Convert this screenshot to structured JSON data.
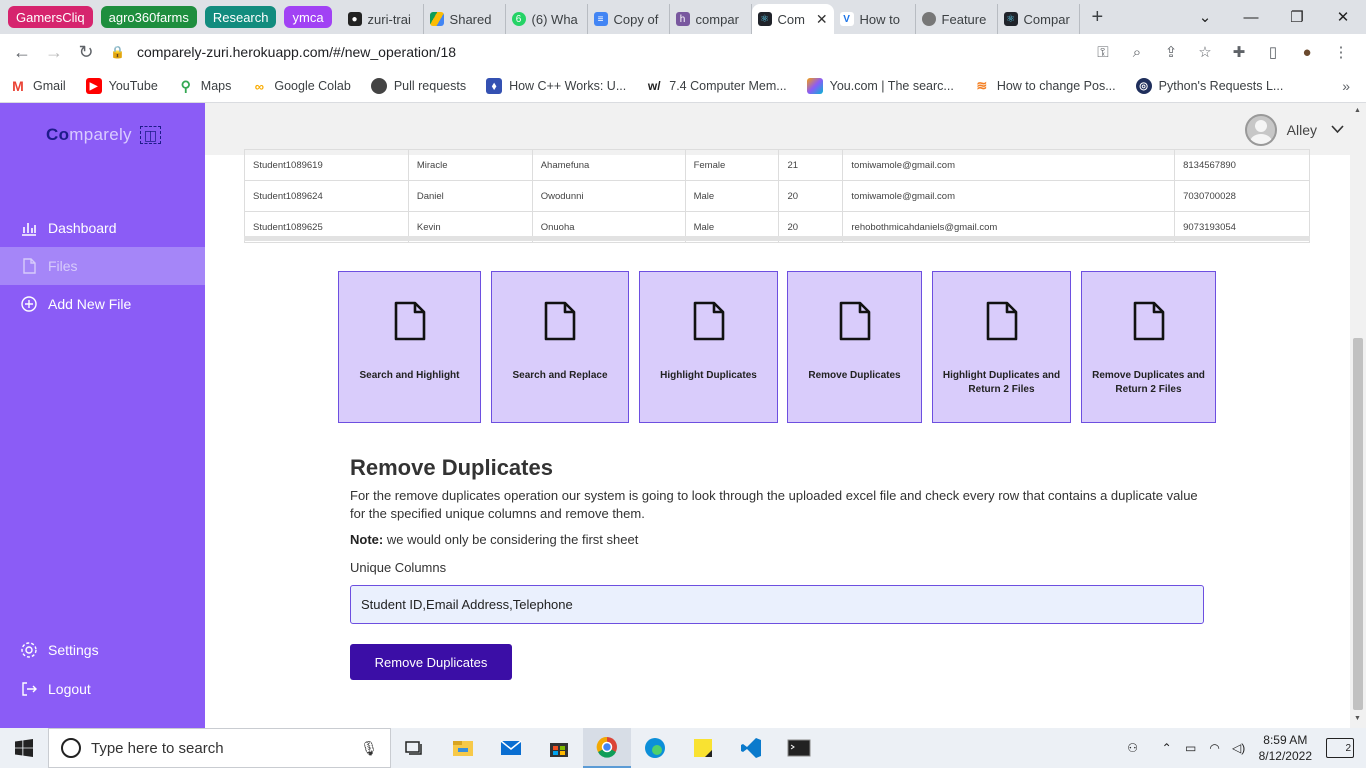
{
  "browser": {
    "tab_groups": [
      {
        "label": "GamersCliq",
        "color": "#d6246e"
      },
      {
        "label": "agro360farms",
        "color": "#1e8e3e"
      },
      {
        "label": "Research",
        "color": "#128c7e"
      },
      {
        "label": "ymca",
        "color": "#a142f4"
      }
    ],
    "tabs": [
      {
        "label": "zuri-trai",
        "icon": "github-icon"
      },
      {
        "label": "Shared",
        "icon": "drive-icon"
      },
      {
        "label": "(6) Wha",
        "icon": "whatsapp-icon"
      },
      {
        "label": "Copy of",
        "icon": "docs-icon"
      },
      {
        "label": "compar",
        "icon": "heroku-icon"
      },
      {
        "label": "Com",
        "icon": "react-icon",
        "active": true
      },
      {
        "label": "How to",
        "icon": "vuejs-icon"
      },
      {
        "label": "Feature",
        "icon": "globe-icon"
      },
      {
        "label": "Compar",
        "icon": "react-icon"
      }
    ],
    "new_tab": "+",
    "url": "comparely-zuri.herokuapp.com/#/new_operation/18",
    "bookmarks": [
      {
        "label": "Gmail",
        "icon": "gmail-icon",
        "color": "#ea4335"
      },
      {
        "label": "YouTube",
        "icon": "youtube-icon",
        "color": "#ff0000"
      },
      {
        "label": "Maps",
        "icon": "maps-icon",
        "color": "#34a853"
      },
      {
        "label": "Google Colab",
        "icon": "colab-icon",
        "color": "#f9ab00"
      },
      {
        "label": "Pull requests",
        "icon": "github-icon",
        "color": "#333333"
      },
      {
        "label": "How C++ Works: U...",
        "icon": "bookmark-icon",
        "color": "#3451b2"
      },
      {
        "label": "7.4 Computer Mem...",
        "icon": "w-icon",
        "color": "#222222"
      },
      {
        "label": "You.com | The searc...",
        "icon": "youcom-icon",
        "color": "#8b5cf6"
      },
      {
        "label": "How to change Pos...",
        "icon": "stackoverflow-icon",
        "color": "#f48024"
      },
      {
        "label": "Python's Requests L...",
        "icon": "python-icon",
        "color": "#1f2f5c"
      }
    ]
  },
  "app": {
    "logo_prefix": "Co",
    "logo_suffix": "mparely",
    "sidebar": {
      "items": [
        {
          "label": "Dashboard",
          "icon": "bar-chart-icon"
        },
        {
          "label": "Files",
          "icon": "file-icon",
          "active": true
        },
        {
          "label": "Add New File",
          "icon": "plus-circle-icon"
        },
        {
          "label": "Settings",
          "icon": "gear-icon"
        },
        {
          "label": "Logout",
          "icon": "logout-icon"
        }
      ]
    },
    "user": {
      "name": "Alley"
    },
    "table": {
      "rows": [
        [
          "Student1089619",
          "Miracle",
          "Ahamefuna",
          "Female",
          "21",
          "tomiwamole@gmail.com",
          "8134567890"
        ],
        [
          "Student1089624",
          "Daniel",
          "Owodunni",
          "Male",
          "20",
          "tomiwamole@gmail.com",
          "7030700028"
        ],
        [
          "Student1089625",
          "Kevin",
          "Onuoha",
          "Male",
          "20",
          "rehobothmicahdaniels@gmail.com",
          "9073193054"
        ]
      ]
    },
    "operations": [
      {
        "label": "Search and Highlight"
      },
      {
        "label": "Search and Replace"
      },
      {
        "label": "Highlight Duplicates"
      },
      {
        "label": "Remove Duplicates"
      },
      {
        "label": "Highlight Duplicates and Return 2 Files"
      },
      {
        "label": "Remove Duplicates and Return 2 Files"
      }
    ],
    "form": {
      "title": "Remove Duplicates",
      "description": "For the remove duplicates operation our system is going to look through the uploaded excel file and check every row that contains a duplicate value for the specified unique columns and remove them.",
      "note_label": "Note:",
      "note_text": "we would only be considering the first sheet",
      "field_label": "Unique Columns",
      "field_value": "Student ID,Email Address,Telephone",
      "submit_label": "Remove Duplicates"
    }
  },
  "taskbar": {
    "search_placeholder": "Type here to search",
    "apps": [
      "task-view-icon",
      "file-explorer-icon",
      "mail-icon",
      "store-icon",
      "chrome-icon",
      "edge-icon",
      "sticky-notes-icon",
      "vscode-icon",
      "terminal-icon"
    ],
    "time": "8:59 AM",
    "date": "8/12/2022",
    "notifications": "2"
  }
}
